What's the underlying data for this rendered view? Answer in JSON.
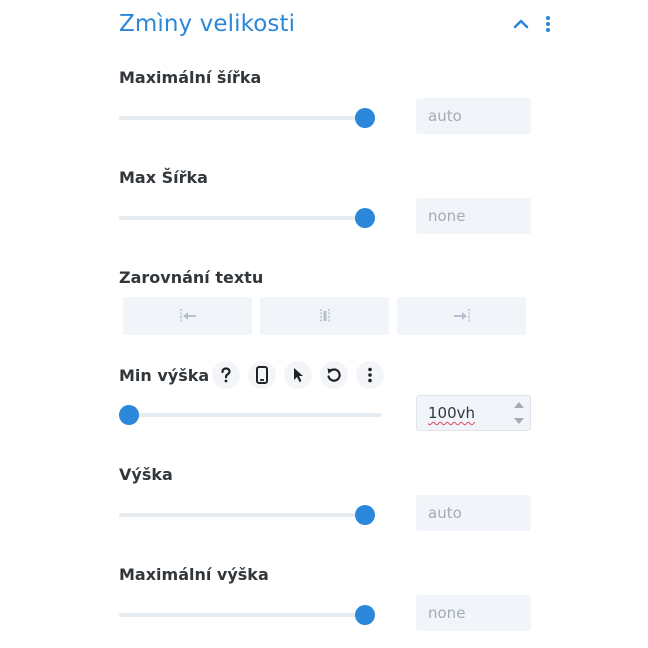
{
  "section": {
    "title": "Zmìny velikosti",
    "collapse_icon": "chevron-up-icon",
    "menu_icon": "kebab-menu-icon"
  },
  "fields": {
    "max_width_1": {
      "label": "Maximální šířka",
      "value": "auto",
      "slider_level": 1.0
    },
    "max_width_2": {
      "label": "Max Šířka",
      "value": "none",
      "slider_level": 1.0
    },
    "text_align": {
      "label": "Zarovnání textu",
      "options": [
        "align-left-icon",
        "align-center-icon",
        "align-right-icon"
      ]
    },
    "min_height": {
      "label": "Min výška",
      "value": "100vh",
      "slider_level": 0.0,
      "option_icons": [
        "help-icon",
        "responsive-phone-icon",
        "hover-cursor-icon",
        "reset-icon",
        "more-options-icon"
      ]
    },
    "height": {
      "label": "Výška",
      "value": "auto",
      "slider_level": 1.0
    },
    "max_height": {
      "label": "Maximální výška",
      "value": "none",
      "slider_level": 1.0
    }
  },
  "colors": {
    "accent": "#2b87da",
    "label": "#32373c",
    "placeholder": "#a3abb5",
    "field_bg": "#f1f5f9",
    "track": "#e6ebf0",
    "spellcheck": "#e0455a"
  }
}
